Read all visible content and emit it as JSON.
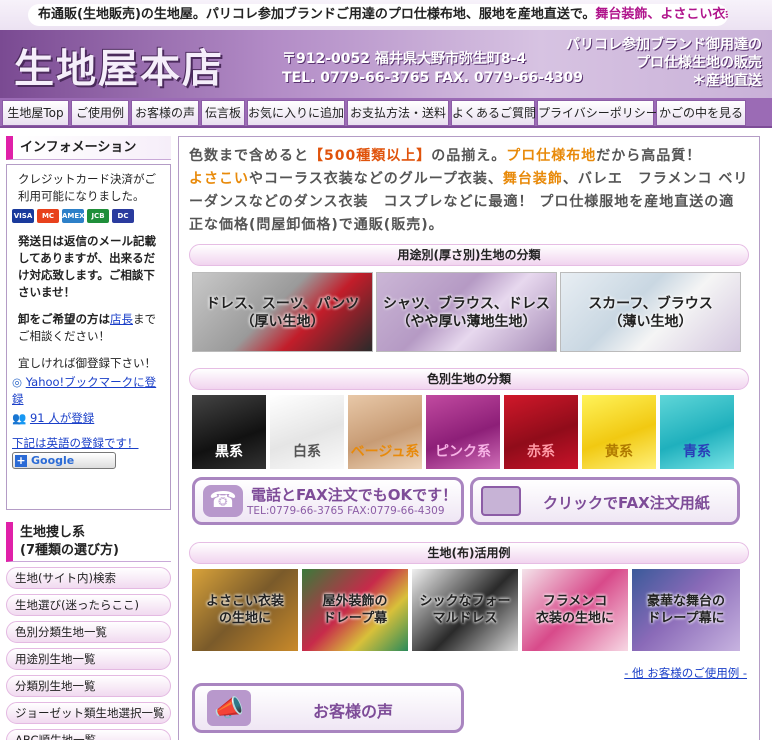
{
  "header": {
    "top_text_plain": "布通販(生地販売)の生地屋。パリコレ参加ブランドご用達のプロ仕様布地、服地を産地直送で。",
    "top_text_accent": "舞台装飾、よさこい衣装",
    "top_text_end": "生地",
    "shop_name": "生地屋本店",
    "address": "〒912-0052 福井県大野市弥生町8-4",
    "tel_fax": "TEL. 0779-66-3765 FAX. 0779-66-4309",
    "tagline_1": "パリコレ参加ブランド御用達の",
    "tagline_2": "プロ仕様生地の販売",
    "tagline_3": "＊産地直送"
  },
  "nav": [
    "生地屋Top",
    "ご使用例",
    "お客様の声",
    "伝言板",
    "お気に入りに追加",
    "お支払方法・送料",
    "よくあるご質問",
    "プライバシーポリシー",
    "かごの中を見る"
  ],
  "sidebar": {
    "info_title": "インフォメーション",
    "info_p1": "クレジットカード決済がご利用可能になりました。",
    "cards": [
      "VISA",
      "MC",
      "AMEX",
      "JCB",
      "DC"
    ],
    "info_p2": "発送日は返信のメール記載してありますが、出来るだけ対応致します。ご相談下さいませ！",
    "info_p3_a": "卸をご希望の方は",
    "info_p3_link": "店長",
    "info_p3_b": "までご相談ください！",
    "info_p4": "宜しければ御登録下さい！",
    "yahoo_link": "Yahoo!ブックマークに登録",
    "users_link": "91 人が登録",
    "english_link": "下記は英語の登録です！",
    "google_btn": "Google",
    "search_title": "生地捜し系\n(7種類の選び方)",
    "search_items": [
      "生地(サイト内)検索",
      "生地選び(迷ったらここ)",
      "色別分類生地一覧",
      "用途別生地一覧",
      "分類別生地一覧",
      "ジョーゼット類生地選択一覧",
      "ABC順生地一覧"
    ]
  },
  "main": {
    "intro_1": "色数まで含めると",
    "intro_hl1": "【500種類以上】",
    "intro_2": "の品揃え。",
    "intro_hl2": "プロ仕様布地",
    "intro_3": "だから高品質！",
    "intro_hl3": "よさこい",
    "intro_4": "やコーラス衣装などのグループ衣装、",
    "intro_hl4": "舞台装飾",
    "intro_5": "、バレエ　フラメンコ ベリーダンスなどのダンス衣装　コスプレなどに最適！ プロ仕様服地を産地直送の適正な価格(問屋卸価格)で通販(販売)。",
    "use_head": "用途別(厚さ別)生地の分類",
    "use_tiles": [
      "ドレス、スーツ、パンツ\n（厚い生地）",
      "シャツ、ブラウス、ドレス\n（やや厚い薄地生地）",
      "スカーフ、ブラウス\n（薄い生地）"
    ],
    "color_head": "色別生地の分類",
    "colors": [
      "黒系",
      "白系",
      "ベージュ系",
      "ピンク系",
      "赤系",
      "黄系",
      "青系"
    ],
    "fax_btn_title": "電話とFAX注文でもOKです！",
    "fax_btn_sub": "TEL:0779-66-3765 FAX:0779-66-4309",
    "fax_form_btn": "クリックでFAX注文用紙",
    "app_head": "生地(布)活用例",
    "apps": [
      "よさこい衣装\nの生地に",
      "屋外装飾の\nドレープ幕",
      "シックなフォー\nマルドレス",
      "フラメンコ\n衣装の生地に",
      "豪華な舞台の\nドレープ幕に"
    ],
    "more_link": "- 他 お客様のご使用例 -",
    "voice_btn": "お客様の声"
  }
}
